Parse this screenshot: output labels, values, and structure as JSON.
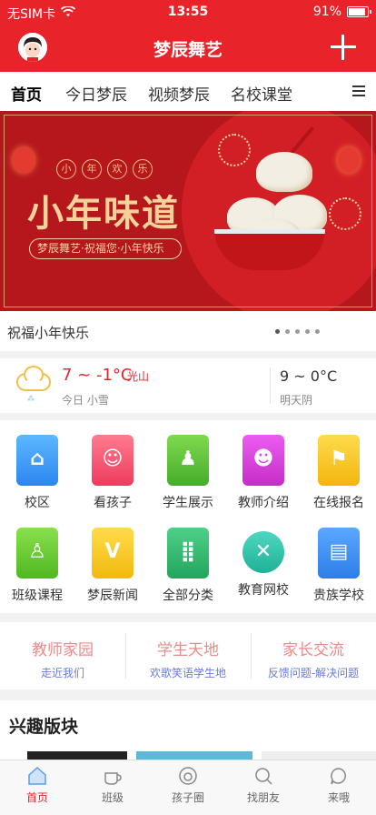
{
  "status": {
    "carrier": "无SIM卡",
    "time": "13:55",
    "battery": "91%"
  },
  "header": {
    "title": "梦辰舞艺"
  },
  "tabs": [
    "首页",
    "今日梦辰",
    "视频梦辰",
    "名校课堂"
  ],
  "banner": {
    "tag_chars": [
      "小",
      "年",
      "欢",
      "乐"
    ],
    "headline": "小年味道",
    "subtitle": "梦辰舞艺·祝福您·小年快乐"
  },
  "caption": "祝福小年快乐",
  "weather": {
    "today_temp": "7 ~ -1°C",
    "city": "光山",
    "today_desc": "今日 小雪",
    "tomorrow_temp": "9 ~ 0°C",
    "tomorrow_desc": "明天阴"
  },
  "grid": [
    {
      "label": "校区",
      "icon": "school-icon",
      "color": "#3b9ef5"
    },
    {
      "label": "看孩子",
      "icon": "child-icon",
      "color": "#f24a6b"
    },
    {
      "label": "学生展示",
      "icon": "student-icon",
      "color": "#5bc236"
    },
    {
      "label": "教师介绍",
      "icon": "teacher-icon",
      "color": "#d33bd8"
    },
    {
      "label": "在线报名",
      "icon": "flag-icon",
      "color": "#f6c21b"
    },
    {
      "label": "班级课程",
      "icon": "class-icon",
      "color": "#62c728"
    },
    {
      "label": "梦辰新闻",
      "icon": "news-icon",
      "color": "#f7c51d"
    },
    {
      "label": "全部分类",
      "icon": "category-icon",
      "color": "#37b86b"
    },
    {
      "label": "教育网校",
      "icon": "edu-icon",
      "color": "#34c2a8"
    },
    {
      "label": "贵族学校",
      "icon": "noble-school-icon",
      "color": "#3a8ff2"
    }
  ],
  "sections": [
    {
      "title": "教师家园",
      "sub": "走近我们",
      "color": "#e88b8b",
      "subcolor": "#6b7bd6"
    },
    {
      "title": "学生天地",
      "sub": "欢歌笑语学生地",
      "color": "#e88b8b",
      "subcolor": "#6b7bd6"
    },
    {
      "title": "家长交流",
      "sub": "反馈问题-解决问题",
      "color": "#e88b8b",
      "subcolor": "#6b7bd6"
    }
  ],
  "interest": {
    "title": "兴趣版块"
  },
  "bottom_nav": [
    "首页",
    "班级",
    "孩子圈",
    "找朋友",
    "来哦"
  ]
}
